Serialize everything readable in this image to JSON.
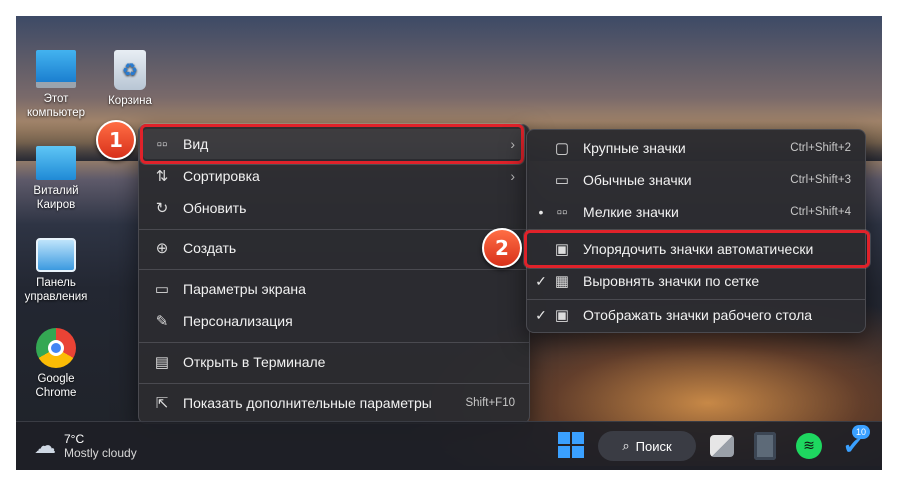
{
  "desktop": {
    "icons": [
      {
        "label": "Этот\nкомпьютер",
        "line1": "Этот",
        "line2": "компьютер",
        "icon": "monitor-icon"
      },
      {
        "label": "Корзина",
        "icon": "recycle-bin-icon"
      },
      {
        "line1": "Виталий",
        "line2": "Каиров",
        "icon": "user-folder-icon"
      },
      {
        "line1": "Панель",
        "line2": "управления",
        "icon": "control-panel-icon"
      },
      {
        "line1": "Google",
        "line2": "Chrome",
        "icon": "chrome-icon"
      }
    ]
  },
  "context_menu": {
    "items": [
      {
        "label": "Вид",
        "icon": "grid-view-icon",
        "has_submenu": true
      },
      {
        "label": "Сортировка",
        "icon": "sort-icon",
        "has_submenu": true
      },
      {
        "label": "Обновить",
        "icon": "refresh-icon"
      },
      {
        "label": "Создать",
        "icon": "plus-circle-icon",
        "has_submenu": true
      },
      {
        "label": "Параметры экрана",
        "icon": "display-settings-icon"
      },
      {
        "label": "Персонализация",
        "icon": "brush-icon"
      },
      {
        "label": "Открыть в Терминале",
        "icon": "terminal-icon"
      },
      {
        "label": "Показать дополнительные параметры",
        "icon": "share-icon",
        "shortcut": "Shift+F10"
      }
    ]
  },
  "view_submenu": {
    "items": [
      {
        "label": "Крупные значки",
        "shortcut": "Ctrl+Shift+2",
        "icon": "large-icons-icon"
      },
      {
        "label": "Обычные значки",
        "shortcut": "Ctrl+Shift+3",
        "icon": "medium-icons-icon"
      },
      {
        "label": "Мелкие значки",
        "shortcut": "Ctrl+Shift+4",
        "icon": "small-icons-icon",
        "bullet": "•"
      },
      {
        "label": "Упорядочить значки автоматически",
        "icon": "auto-arrange-icon"
      },
      {
        "label": "Выровнять значки по сетке",
        "icon": "align-grid-icon",
        "check": "✓"
      },
      {
        "label": "Отображать значки рабочего стола",
        "icon": "show-desktop-icons-icon",
        "check": "✓"
      }
    ]
  },
  "callouts": {
    "one": "1",
    "two": "2"
  },
  "taskbar": {
    "weather_temp": "7°C",
    "weather_desc": "Mostly cloudy",
    "search_label": "Поиск",
    "badge_count": "10"
  },
  "colors": {
    "highlight": "#e0222a",
    "badge": "#d8311a",
    "menu_bg": "#2c2c30"
  }
}
